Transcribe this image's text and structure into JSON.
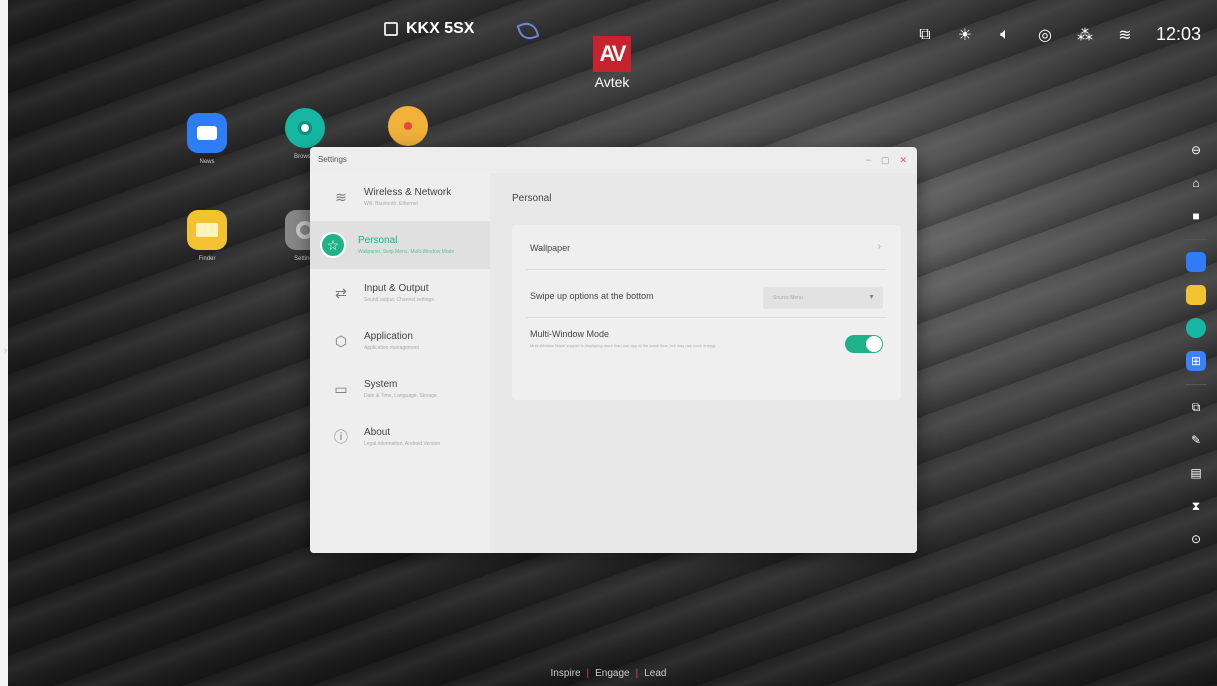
{
  "statusbar": {
    "room_name": "KKX 5SX",
    "clock": "12:03",
    "tray_icons": [
      "screen-mirror-icon",
      "brightness-icon",
      "volume-icon",
      "nfc-icon",
      "network-icon",
      "wifi-icon"
    ]
  },
  "logo": {
    "mark": "AV",
    "word": "Avtek"
  },
  "desktop_icons": [
    {
      "name": "News",
      "color": "#2f7df4"
    },
    {
      "name": "Browser",
      "color": "#16b7a2"
    },
    {
      "name": "",
      "color": "#f1b13b"
    },
    {
      "name": "Finder",
      "color": "#f2c230"
    },
    {
      "name": "Settings",
      "color": "#888888"
    }
  ],
  "window": {
    "title": "Settings",
    "controls": [
      "−",
      "▢",
      "✕"
    ],
    "sidebar": [
      {
        "title": "Wireless & Network",
        "sub": "Wifi, Bluetooth, Ethernet",
        "icon": "wifi-icon",
        "active": false
      },
      {
        "title": "Personal",
        "sub": "Wallpaper, Swip Menu, Multi-Window Mode",
        "icon": "star-icon",
        "active": true
      },
      {
        "title": "Input & Output",
        "sub": "Sound output, Channel settings",
        "icon": "arrows-icon",
        "active": false
      },
      {
        "title": "Application",
        "sub": "Application management",
        "icon": "app-icon",
        "active": false
      },
      {
        "title": "System",
        "sub": "Date & Time, Language, Storage",
        "icon": "monitor-icon",
        "active": false
      },
      {
        "title": "About",
        "sub": "Legal information, Android Version",
        "icon": "info-icon",
        "active": false
      }
    ],
    "content": {
      "heading": "Personal",
      "wallpaper_label": "Wallpaper",
      "swipe_label": "Swipe up options at the bottom",
      "swipe_value": "Source Menu",
      "multi_label": "Multi-Window Mode",
      "multi_sub": "Multi-Window Mode support is displaying more than one app at the same time, but may use more energy",
      "multi_enabled": true
    }
  },
  "footer": {
    "a": "Inspire",
    "b": "Engage",
    "c": "Lead"
  },
  "colors": {
    "accent": "#1fb187",
    "brand": "#c7232e"
  }
}
